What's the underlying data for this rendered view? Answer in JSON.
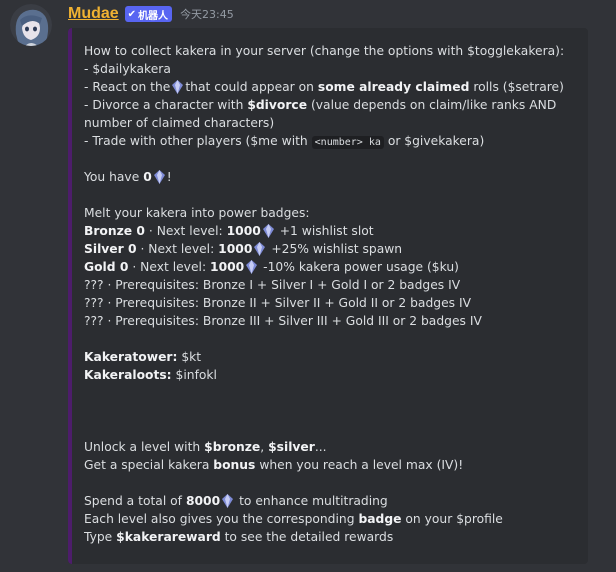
{
  "message": {
    "username": "Mudae",
    "bot_tag": "机器人",
    "timestamp": "今天23:45"
  },
  "colors": {
    "username": "#f0b232",
    "embed_bar": "#4d1d6b",
    "embed_bg": "#2b2d31",
    "page_bg": "#313338",
    "bot_tag": "#5865f2"
  },
  "icons": [
    "bot-check-icon",
    "kakera-crystal-icon"
  ],
  "embed": {
    "l1": "How to collect kakera in your server (change the options with $togglekakera):",
    "l2": "- $dailykakera",
    "l3a": "- React on the",
    "l3b": "that could appear on",
    "l3c": "some already claimed",
    "l3d": "rolls ($setrare)",
    "l4a": "- Divorce a character with",
    "l4b": "$divorce",
    "l4c": "(value depends on claim/like ranks AND",
    "l5": "number of claimed characters)",
    "l6a": "- Trade with other players ($me with",
    "l6b": "<number> ka",
    "l6c": "or $givekakera)",
    "have_a": "You have",
    "have_b": "0",
    "have_c": "!",
    "melt": "Melt your kakera into power badges:",
    "badges": [
      {
        "name": "Bronze 0",
        "mid": "· Next level:",
        "cost": "1000",
        "bonus": "+1 wishlist slot"
      },
      {
        "name": "Silver 0",
        "mid": "· Next level:",
        "cost": "1000",
        "bonus": "+25% wishlist spawn"
      },
      {
        "name": "Gold 0",
        "mid": "· Next level:",
        "cost": "1000",
        "bonus": "-10% kakera power usage ($ku)"
      }
    ],
    "pre1": "??? · Prerequisites: Bronze I + Silver I + Gold I or 2 badges IV",
    "pre2": "??? · Prerequisites: Bronze II + Silver II + Gold II or 2 badges IV",
    "pre3": "??? · Prerequisites: Bronze III + Silver III + Gold III or 2 badges IV",
    "tower_label": "Kakeratower:",
    "tower_cmd": "$kt",
    "loots_label": "Kakeraloots:",
    "loots_cmd": "$infokl",
    "unlock_a": "Unlock a level with",
    "unlock_b": "$bronze",
    "unlock_c": ",",
    "unlock_d": "$silver",
    "unlock_e": "...",
    "special_a": "Get a special kakera",
    "special_b": "bonus",
    "special_c": "when you reach a level max (IV)!",
    "spend_a": "Spend a total of",
    "spend_b": "8000",
    "spend_c": "to enhance multitrading",
    "each_a": "Each level also gives you the corresponding",
    "each_b": "badge",
    "each_c": "on your $profile",
    "type_a": "Type",
    "type_b": "$kakerareward",
    "type_c": "to see the detailed rewards"
  }
}
